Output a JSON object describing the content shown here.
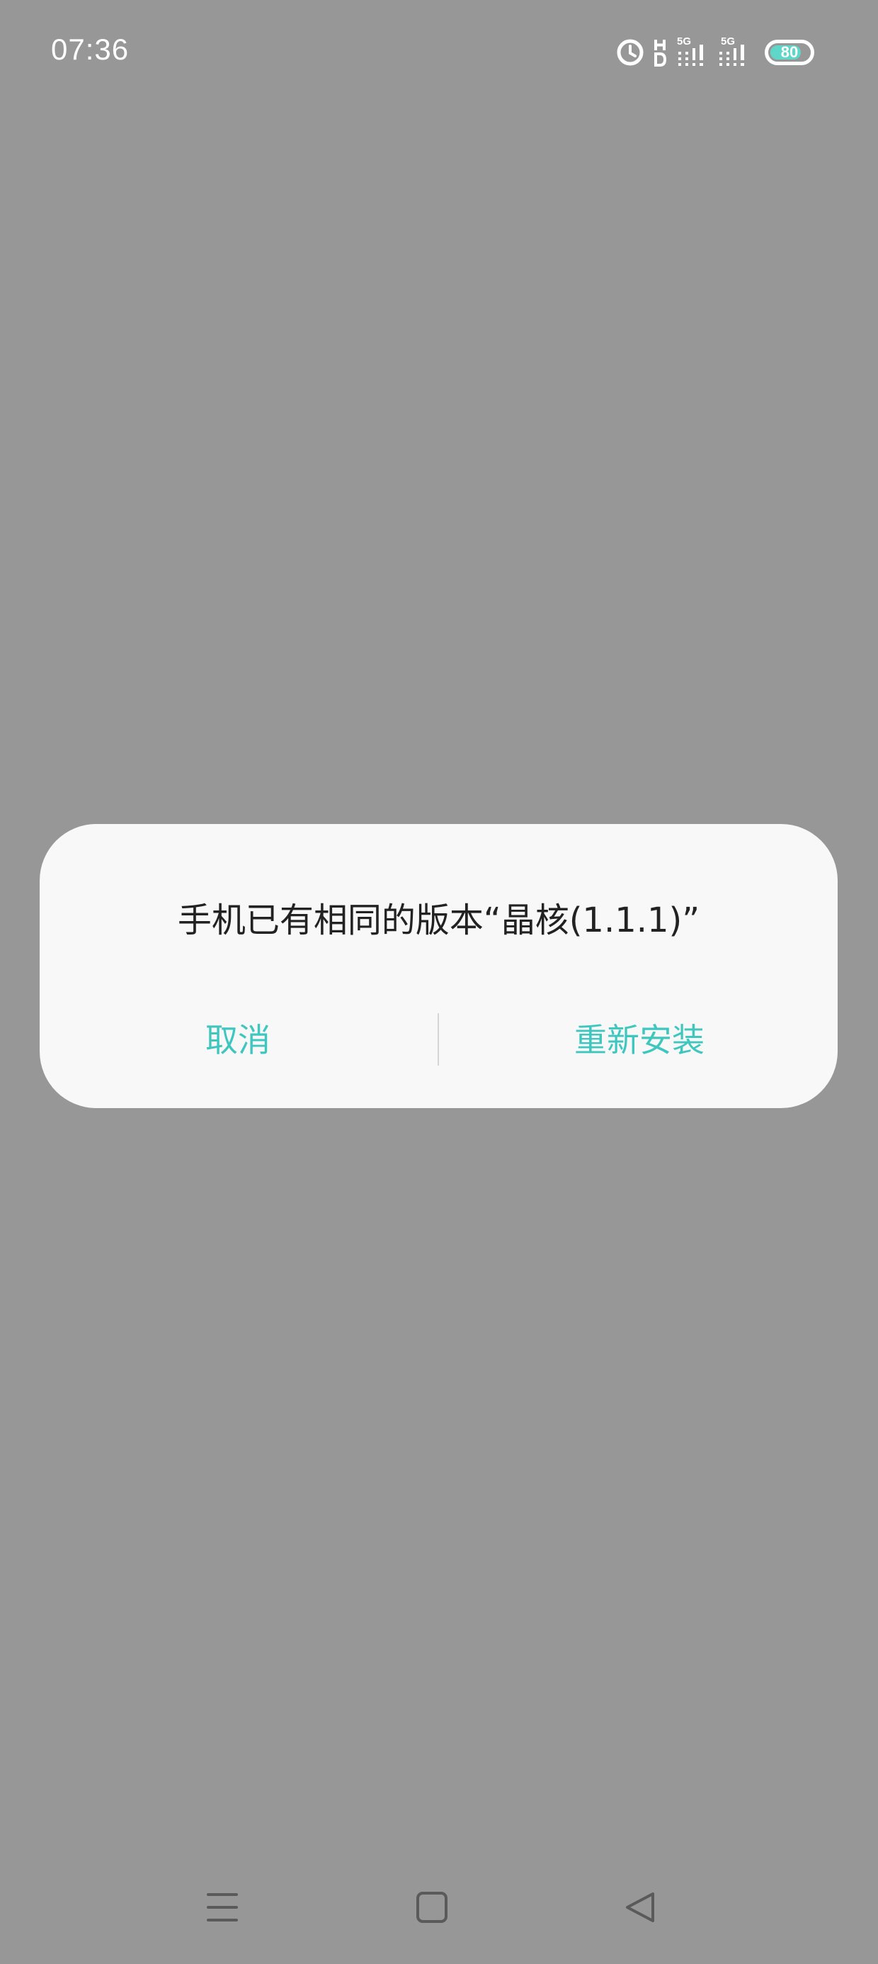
{
  "status_bar": {
    "time": "07:36",
    "network_1": "5G",
    "network_2": "5G",
    "battery_level": "80",
    "battery_fraction": 0.8,
    "icons": [
      "alarm-icon",
      "hd-icon",
      "signal-icon",
      "signal-icon",
      "battery-icon"
    ]
  },
  "dialog": {
    "message": "手机已有相同的版本“晶核(1.1.1)”",
    "cancel_label": "取消",
    "reinstall_label": "重新安装"
  },
  "nav_bar": {
    "icons": [
      "menu-icon",
      "home-icon",
      "back-icon"
    ]
  },
  "colors": {
    "accent": "#3fc7bf",
    "scrim": "#979797",
    "dialog_bg": "#f8f8f8"
  }
}
